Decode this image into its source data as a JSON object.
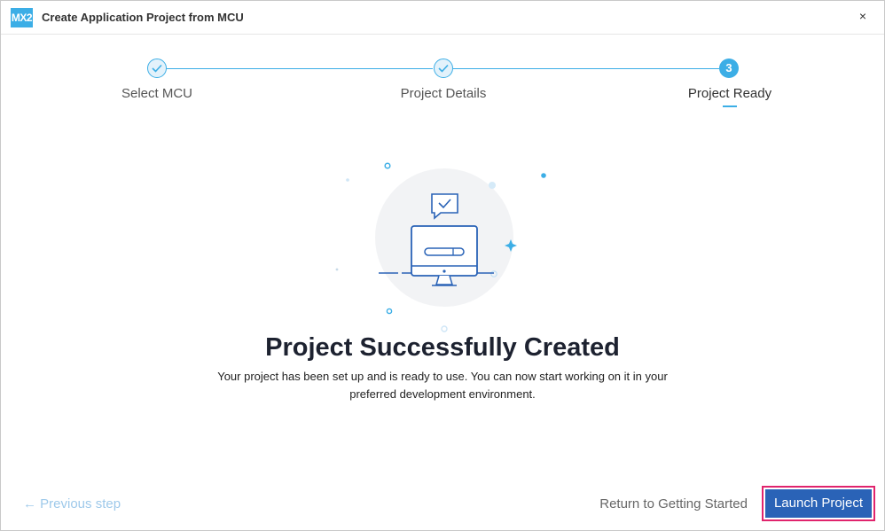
{
  "window": {
    "logo_text": "MX2",
    "title": "Create Application Project from MCU",
    "close_glyph": "×"
  },
  "stepper": {
    "steps": [
      {
        "label": "Select MCU",
        "state": "completed",
        "icon": "check-icon"
      },
      {
        "label": "Project Details",
        "state": "completed",
        "icon": "check-icon"
      },
      {
        "label": "Project Ready",
        "state": "active",
        "number": "3"
      }
    ]
  },
  "content": {
    "headline": "Project Successfully Created",
    "description_line1": "Your project has been set up and is ready to use. You can now start working on it in your",
    "description_line2": "preferred development environment.",
    "illustration_icon": "computer-success-icon"
  },
  "footer": {
    "previous_label": "← Previous step",
    "return_label": "Return to Getting Started",
    "launch_label": "Launch Project"
  },
  "colors": {
    "accent": "#3caee6",
    "primary_button": "#2a63b7",
    "focus_ring": "#e0246d",
    "disabled_text": "#9ec9ea"
  }
}
